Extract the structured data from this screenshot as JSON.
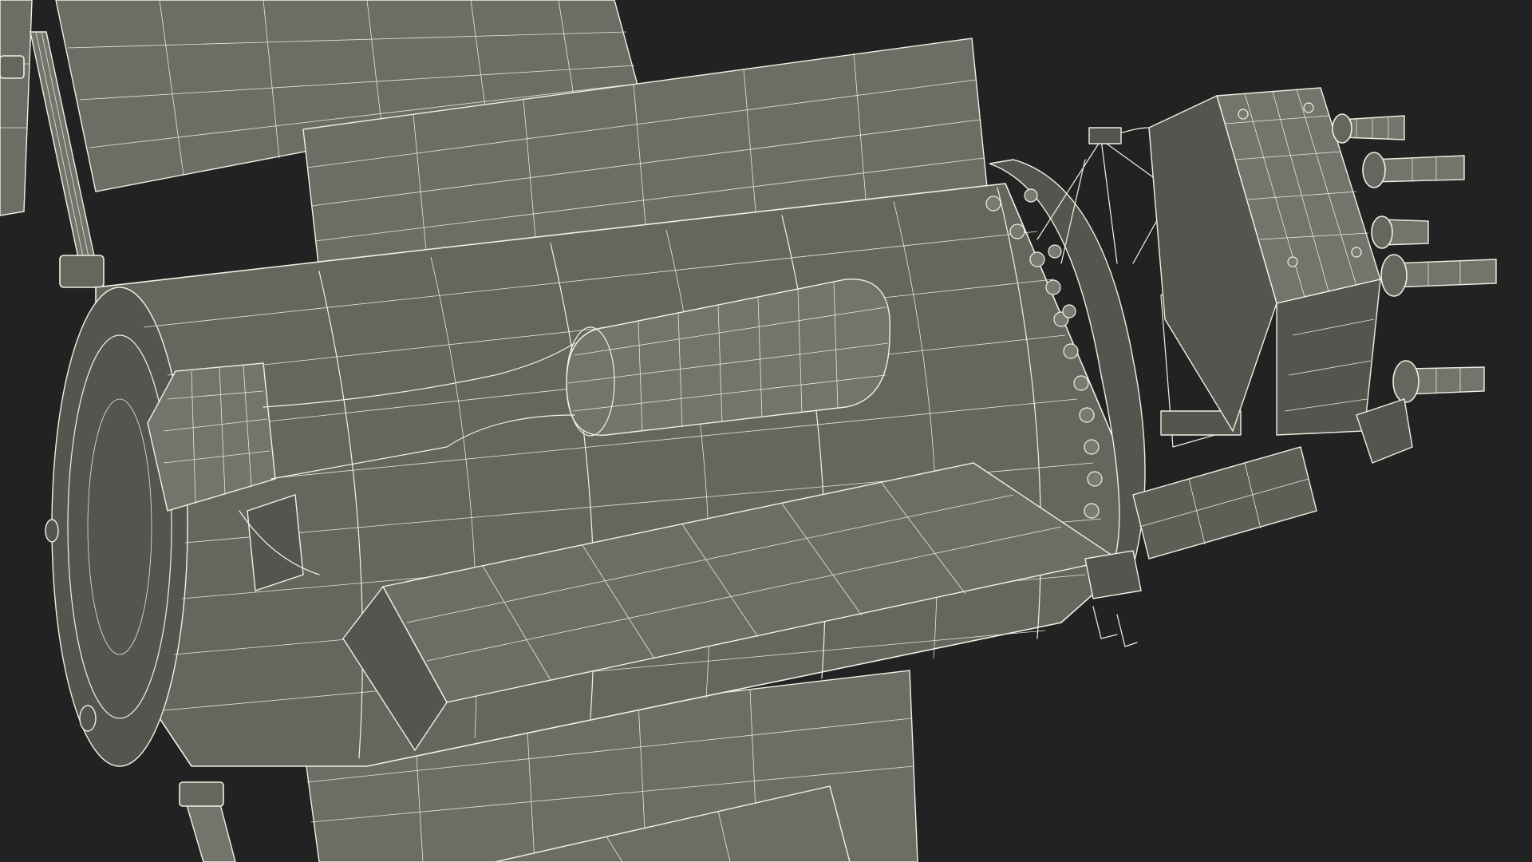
{
  "scene": {
    "subject": "satellite-wireframe-render",
    "background_color": "#222222",
    "mesh_fill_color": "#6b6b63",
    "wire_color": "#f0f0e4"
  }
}
